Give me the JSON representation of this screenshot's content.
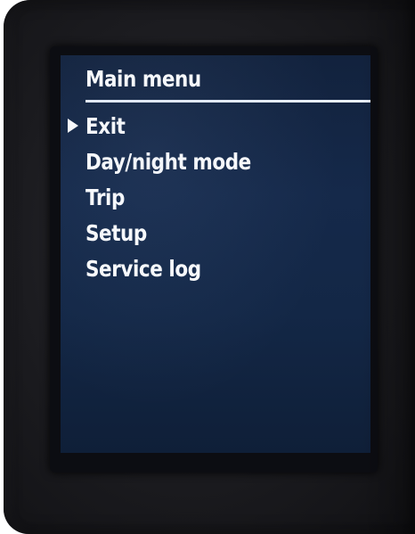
{
  "menu": {
    "title": "Main menu",
    "selected_index": 0,
    "cursor_icon": "play-triangle-icon",
    "items": [
      {
        "label": "Exit"
      },
      {
        "label": "Day/night mode"
      },
      {
        "label": "Trip"
      },
      {
        "label": "Setup"
      },
      {
        "label": "Service log"
      }
    ]
  },
  "colors": {
    "screen_background": "#14284a",
    "text": "#ffffff",
    "device_body": "#1b1b1f"
  }
}
